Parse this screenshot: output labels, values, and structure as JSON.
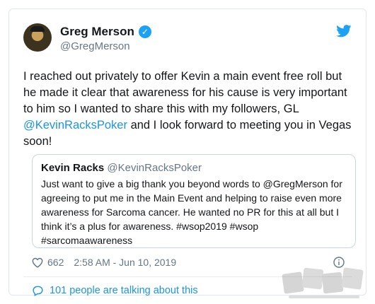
{
  "author": {
    "display_name": "Greg Merson",
    "handle": "@GregMerson",
    "verified_glyph": "✓"
  },
  "tweet": {
    "text_before": "I reached out privately to offer Kevin a main event free roll but\nhe made it clear that awareness for his cause is very important\nto him so I wanted to share this with my followers, GL\n",
    "mention": "@KevinRacksPoker",
    "text_after": " and I look forward to meeting you in Vegas\nsoon!"
  },
  "quoted": {
    "name": "Kevin Racks",
    "handle": "@KevinRacksPoker",
    "text": "Just want to give a big thank you beyond words to @GregMerson for\nagreeing to put me in the Main Event and helping to raise even more\nawareness for Sarcoma cancer. He wanted no PR for this at all but I\nthink it’s a plus for awareness.   #wsop2019 #wsop\n#sarcomaawareness"
  },
  "meta": {
    "likes": "662",
    "timestamp": "2:58 AM - Jun 10, 2019"
  },
  "footer": {
    "talking": "101 people are talking about this"
  },
  "icons": {
    "bird": "twitter-bird-icon",
    "heart": "heart-icon",
    "info": "info-icon",
    "comment": "comment-icon"
  },
  "colors": {
    "brand": "#1da1f2",
    "link": "#1b95e0",
    "muted": "#657786"
  }
}
